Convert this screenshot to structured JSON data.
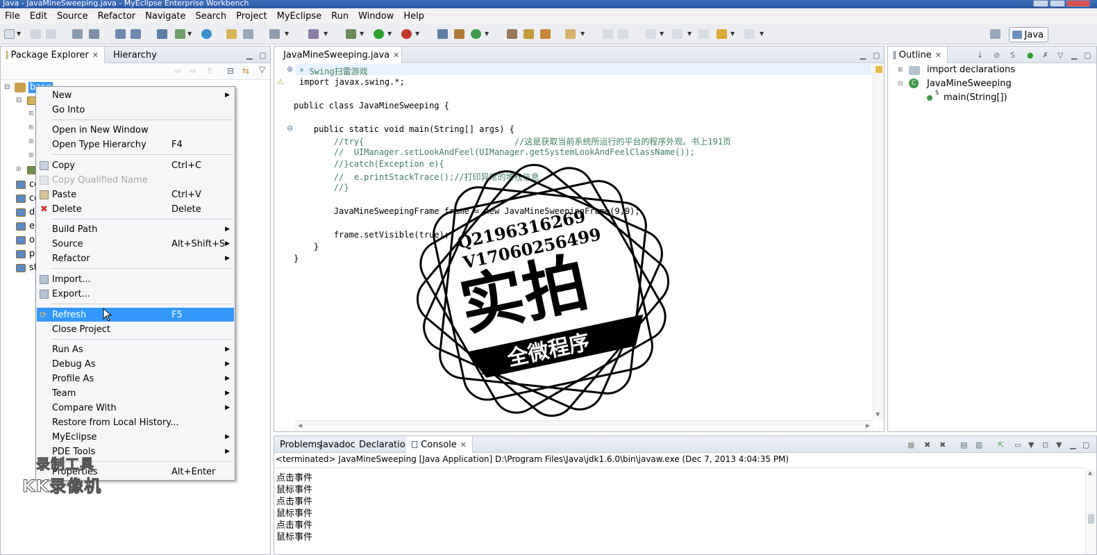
{
  "window": {
    "title": "Java - JavaMineSweeping.java - MyEclipse Enterprise Workbench"
  },
  "menubar": [
    "File",
    "Edit",
    "Source",
    "Refactor",
    "Navigate",
    "Search",
    "Project",
    "MyEclipse",
    "Run",
    "Window",
    "Help"
  ],
  "perspective": {
    "label": "Java"
  },
  "package_explorer": {
    "tabs": [
      {
        "label": "Package Explorer"
      },
      {
        "label": "Hierarchy"
      }
    ],
    "selected_project": "base",
    "partial_items": [
      "co",
      "co",
      "d",
      "e",
      "o",
      "p",
      "st"
    ]
  },
  "context_menu": {
    "items": [
      {
        "label": "New",
        "accel": "",
        "submenu": true
      },
      {
        "label": "Go Into",
        "accel": "",
        "submenu": false
      },
      {
        "label": "Open in New Window",
        "accel": "",
        "submenu": false
      },
      {
        "label": "Open Type Hierarchy",
        "accel": "F4",
        "submenu": false
      },
      {
        "label": "Copy",
        "accel": "Ctrl+C",
        "submenu": false
      },
      {
        "label": "Copy Qualified Name",
        "accel": "",
        "submenu": false,
        "disabled": true
      },
      {
        "label": "Paste",
        "accel": "Ctrl+V",
        "submenu": false
      },
      {
        "label": "Delete",
        "accel": "Delete",
        "submenu": false
      },
      {
        "label": "Build Path",
        "accel": "",
        "submenu": true
      },
      {
        "label": "Source",
        "accel": "Alt+Shift+S",
        "submenu": true
      },
      {
        "label": "Refactor",
        "accel": "",
        "submenu": true
      },
      {
        "label": "Import...",
        "accel": "",
        "submenu": false
      },
      {
        "label": "Export...",
        "accel": "",
        "submenu": false
      },
      {
        "label": "Refresh",
        "accel": "F5",
        "submenu": false,
        "highlighted": true
      },
      {
        "label": "Close Project",
        "accel": "",
        "submenu": false
      },
      {
        "label": "Run As",
        "accel": "",
        "submenu": true
      },
      {
        "label": "Debug As",
        "accel": "",
        "submenu": true
      },
      {
        "label": "Profile As",
        "accel": "",
        "submenu": true
      },
      {
        "label": "Team",
        "accel": "",
        "submenu": true
      },
      {
        "label": "Compare With",
        "accel": "",
        "submenu": true
      },
      {
        "label": "Restore from Local History...",
        "accel": "",
        "submenu": false
      },
      {
        "label": "MyEclipse",
        "accel": "",
        "submenu": true
      },
      {
        "label": "PDE Tools",
        "accel": "",
        "submenu": true
      },
      {
        "label": "Properties",
        "accel": "Alt+Enter",
        "submenu": false
      }
    ]
  },
  "editor": {
    "tab_label": "JavaMineSweeping.java",
    "lines": [
      "* Swing扫雷游戏",
      "import javax.swing.*;",
      "",
      "public class JavaMineSweeping {",
      "",
      "    public static void main(String[] args) {",
      "        //try{                              //这是获取当前系统所运行的平台的程序外观。书上191页",
      "        //  UIManager.setLookAndFeel(UIManager.getSystemLookAndFeelClassName());",
      "        //}catch(Exception e){",
      "        //  e.printStackTrace();//打印异常的堆栈信息",
      "        //}",
      "",
      "        JavaMineSweepingFrame frame = new JavaMineSweepingFrame(9,9);",
      "",
      "        frame.setVisible(true);",
      "    }",
      "}"
    ]
  },
  "outline": {
    "tab_label": "Outline",
    "items": [
      {
        "label": "import declarations"
      },
      {
        "label": "JavaMineSweeping"
      },
      {
        "label": "main(String[])"
      }
    ]
  },
  "bottom_panel": {
    "tabs": [
      {
        "label": "Problems"
      },
      {
        "label": "Javadoc"
      },
      {
        "label": "Declaration"
      },
      {
        "label": "Console"
      }
    ],
    "status": "<terminated> JavaMineSweeping [Java Application] D:\\Program Files\\Java\\jdk1.6.0\\bin\\javaw.exe (Dec 7, 2013 4:04:35 PM)",
    "output": [
      "点击事件",
      "鼠标事件",
      "点击事件",
      "鼠标事件",
      "点击事件",
      "鼠标事件"
    ]
  },
  "stamp": {
    "line1": "Q2196316269",
    "line2": "V17060256499",
    "big": "实拍",
    "banner": "全微程序"
  },
  "recorder_watermark": {
    "line1": "录制工具",
    "line2": "KK录像机"
  },
  "colors": {
    "highlight": "#3399ff",
    "keyword": "#7f0055",
    "comment": "#3f7f5f",
    "number": "#0000c0"
  }
}
